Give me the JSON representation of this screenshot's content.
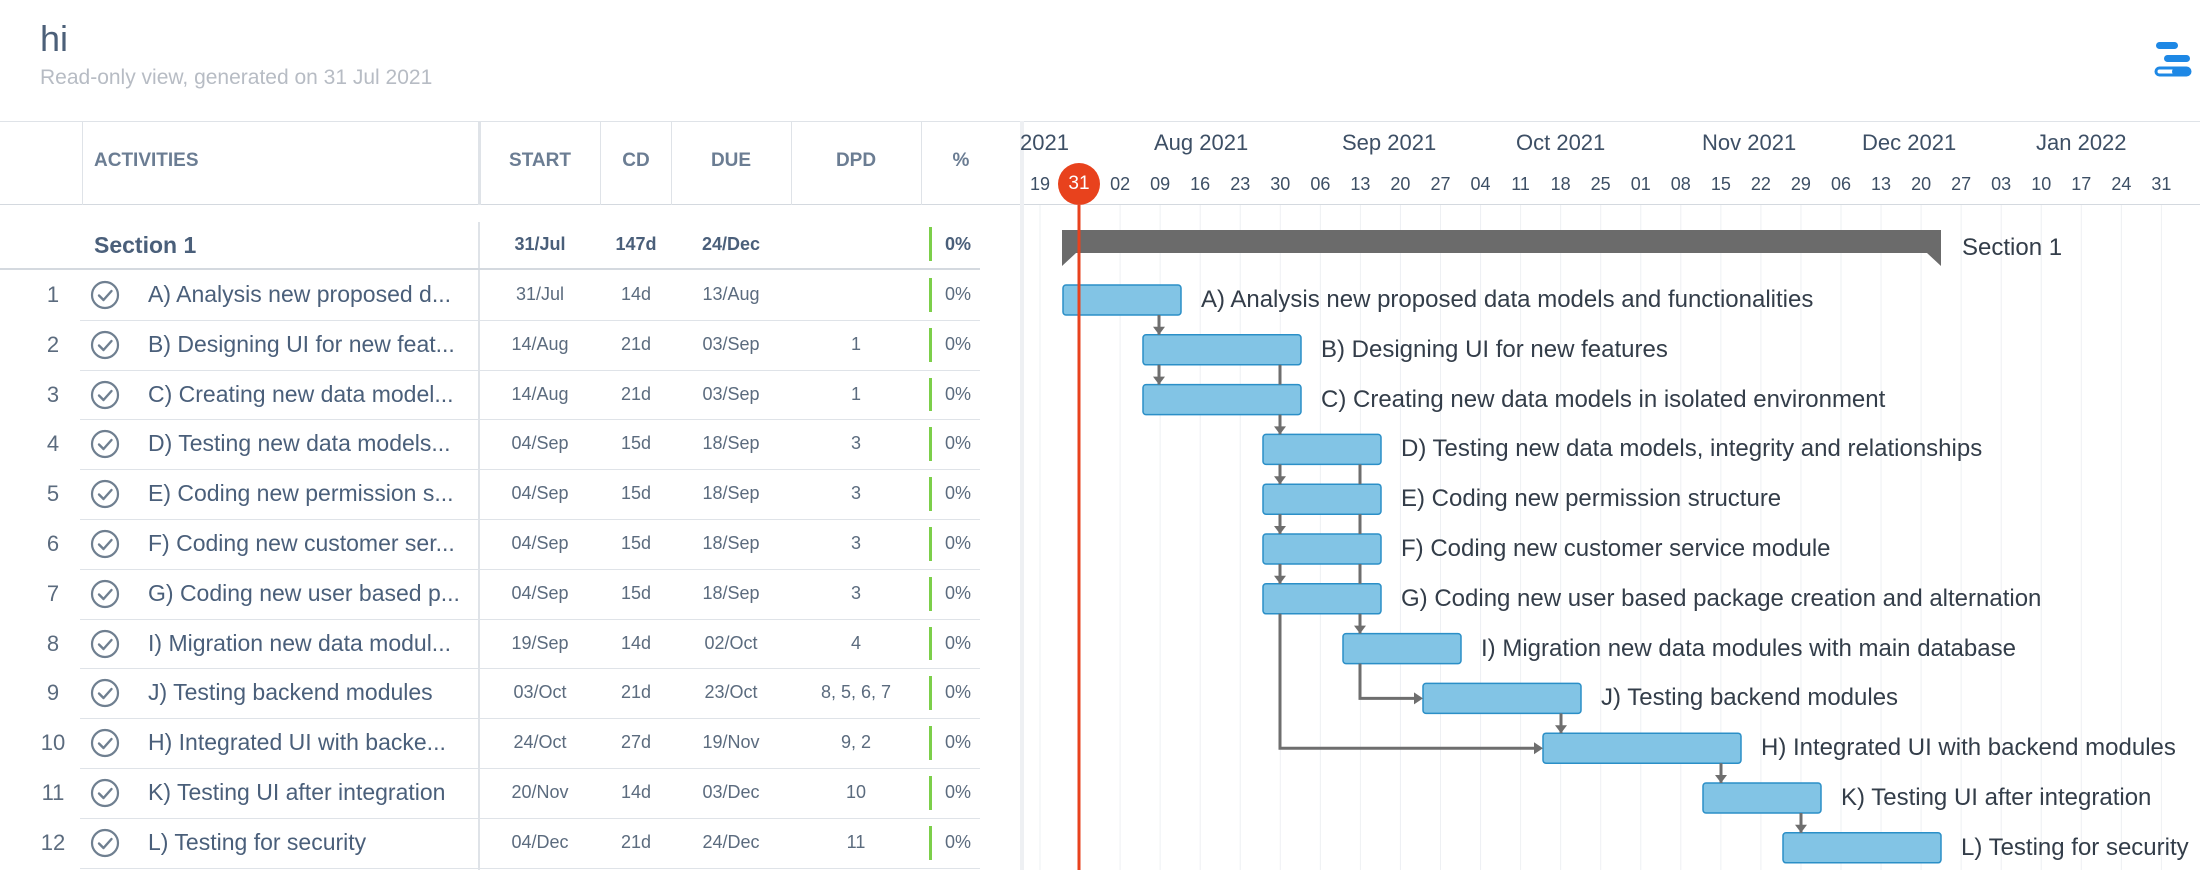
{
  "header": {
    "title": "hi",
    "subtitle": "Read-only view, generated on 31 Jul 2021"
  },
  "table": {
    "columns": [
      "ACTIVITIES",
      "START",
      "CD",
      "DUE",
      "DPD",
      "%"
    ],
    "section": {
      "name": "Section 1",
      "start": "31/Jul",
      "cd": "147d",
      "due": "24/Dec",
      "pct": "0%"
    },
    "rows": [
      {
        "num": "1",
        "name": "A) Analysis new proposed d...",
        "start": "31/Jul",
        "cd": "14d",
        "due": "13/Aug",
        "dpd": "",
        "pct": "0%"
      },
      {
        "num": "2",
        "name": "B) Designing UI for new feat...",
        "start": "14/Aug",
        "cd": "21d",
        "due": "03/Sep",
        "dpd": "1",
        "pct": "0%"
      },
      {
        "num": "3",
        "name": "C) Creating new data model...",
        "start": "14/Aug",
        "cd": "21d",
        "due": "03/Sep",
        "dpd": "1",
        "pct": "0%"
      },
      {
        "num": "4",
        "name": "D) Testing new data models...",
        "start": "04/Sep",
        "cd": "15d",
        "due": "18/Sep",
        "dpd": "3",
        "pct": "0%"
      },
      {
        "num": "5",
        "name": "E) Coding new permission s...",
        "start": "04/Sep",
        "cd": "15d",
        "due": "18/Sep",
        "dpd": "3",
        "pct": "0%"
      },
      {
        "num": "6",
        "name": "F) Coding new customer ser...",
        "start": "04/Sep",
        "cd": "15d",
        "due": "18/Sep",
        "dpd": "3",
        "pct": "0%"
      },
      {
        "num": "7",
        "name": "G) Coding new user based p...",
        "start": "04/Sep",
        "cd": "15d",
        "due": "18/Sep",
        "dpd": "3",
        "pct": "0%"
      },
      {
        "num": "8",
        "name": "I) Migration new data modul...",
        "start": "19/Sep",
        "cd": "14d",
        "due": "02/Oct",
        "dpd": "4",
        "pct": "0%"
      },
      {
        "num": "9",
        "name": "J) Testing backend modules",
        "start": "03/Oct",
        "cd": "21d",
        "due": "23/Oct",
        "dpd": "8, 5, 6, 7",
        "pct": "0%"
      },
      {
        "num": "10",
        "name": "H) Integrated UI with backe...",
        "start": "24/Oct",
        "cd": "27d",
        "due": "19/Nov",
        "dpd": "9, 2",
        "pct": "0%"
      },
      {
        "num": "11",
        "name": "K) Testing UI after integration",
        "start": "20/Nov",
        "cd": "14d",
        "due": "03/Dec",
        "dpd": "10",
        "pct": "0%"
      },
      {
        "num": "12",
        "name": "L) Testing for security",
        "start": "04/Dec",
        "cd": "21d",
        "due": "24/Dec",
        "dpd": "11",
        "pct": "0%"
      }
    ]
  },
  "timeline": {
    "months": [
      "2021",
      "Aug 2021",
      "Sep 2021",
      "Oct 2021",
      "Nov 2021",
      "Dec 2021",
      "Jan 2022"
    ],
    "days": [
      "19",
      "31",
      "02",
      "09",
      "16",
      "23",
      "30",
      "06",
      "13",
      "20",
      "27",
      "04",
      "11",
      "18",
      "25",
      "01",
      "08",
      "15",
      "22",
      "29",
      "06",
      "13",
      "20",
      "27",
      "03",
      "10",
      "17",
      "24",
      "31"
    ],
    "today_label": "31",
    "section_label": "Section 1",
    "task_labels": [
      "A) Analysis new proposed data models and functionalities",
      "B) Designing UI for new features",
      "C) Creating new data models in isolated environment",
      "D) Testing new data models, integrity and relationships",
      "E) Coding new permission structure",
      "F) Coding new customer service module",
      "G) Coding new user based package creation and alternation",
      "I) Migration new data modules with main database",
      "J) Testing backend modules",
      "H) Integrated UI with backend modules",
      "K) Testing UI after integration",
      "L) Testing for security"
    ]
  },
  "colors": {
    "bar_fill": "#82c4e5",
    "bar_stroke": "#2b8fc7",
    "today": "#e8421d",
    "section_bar": "#6b6b6b",
    "progress": "#7ccf4a"
  }
}
